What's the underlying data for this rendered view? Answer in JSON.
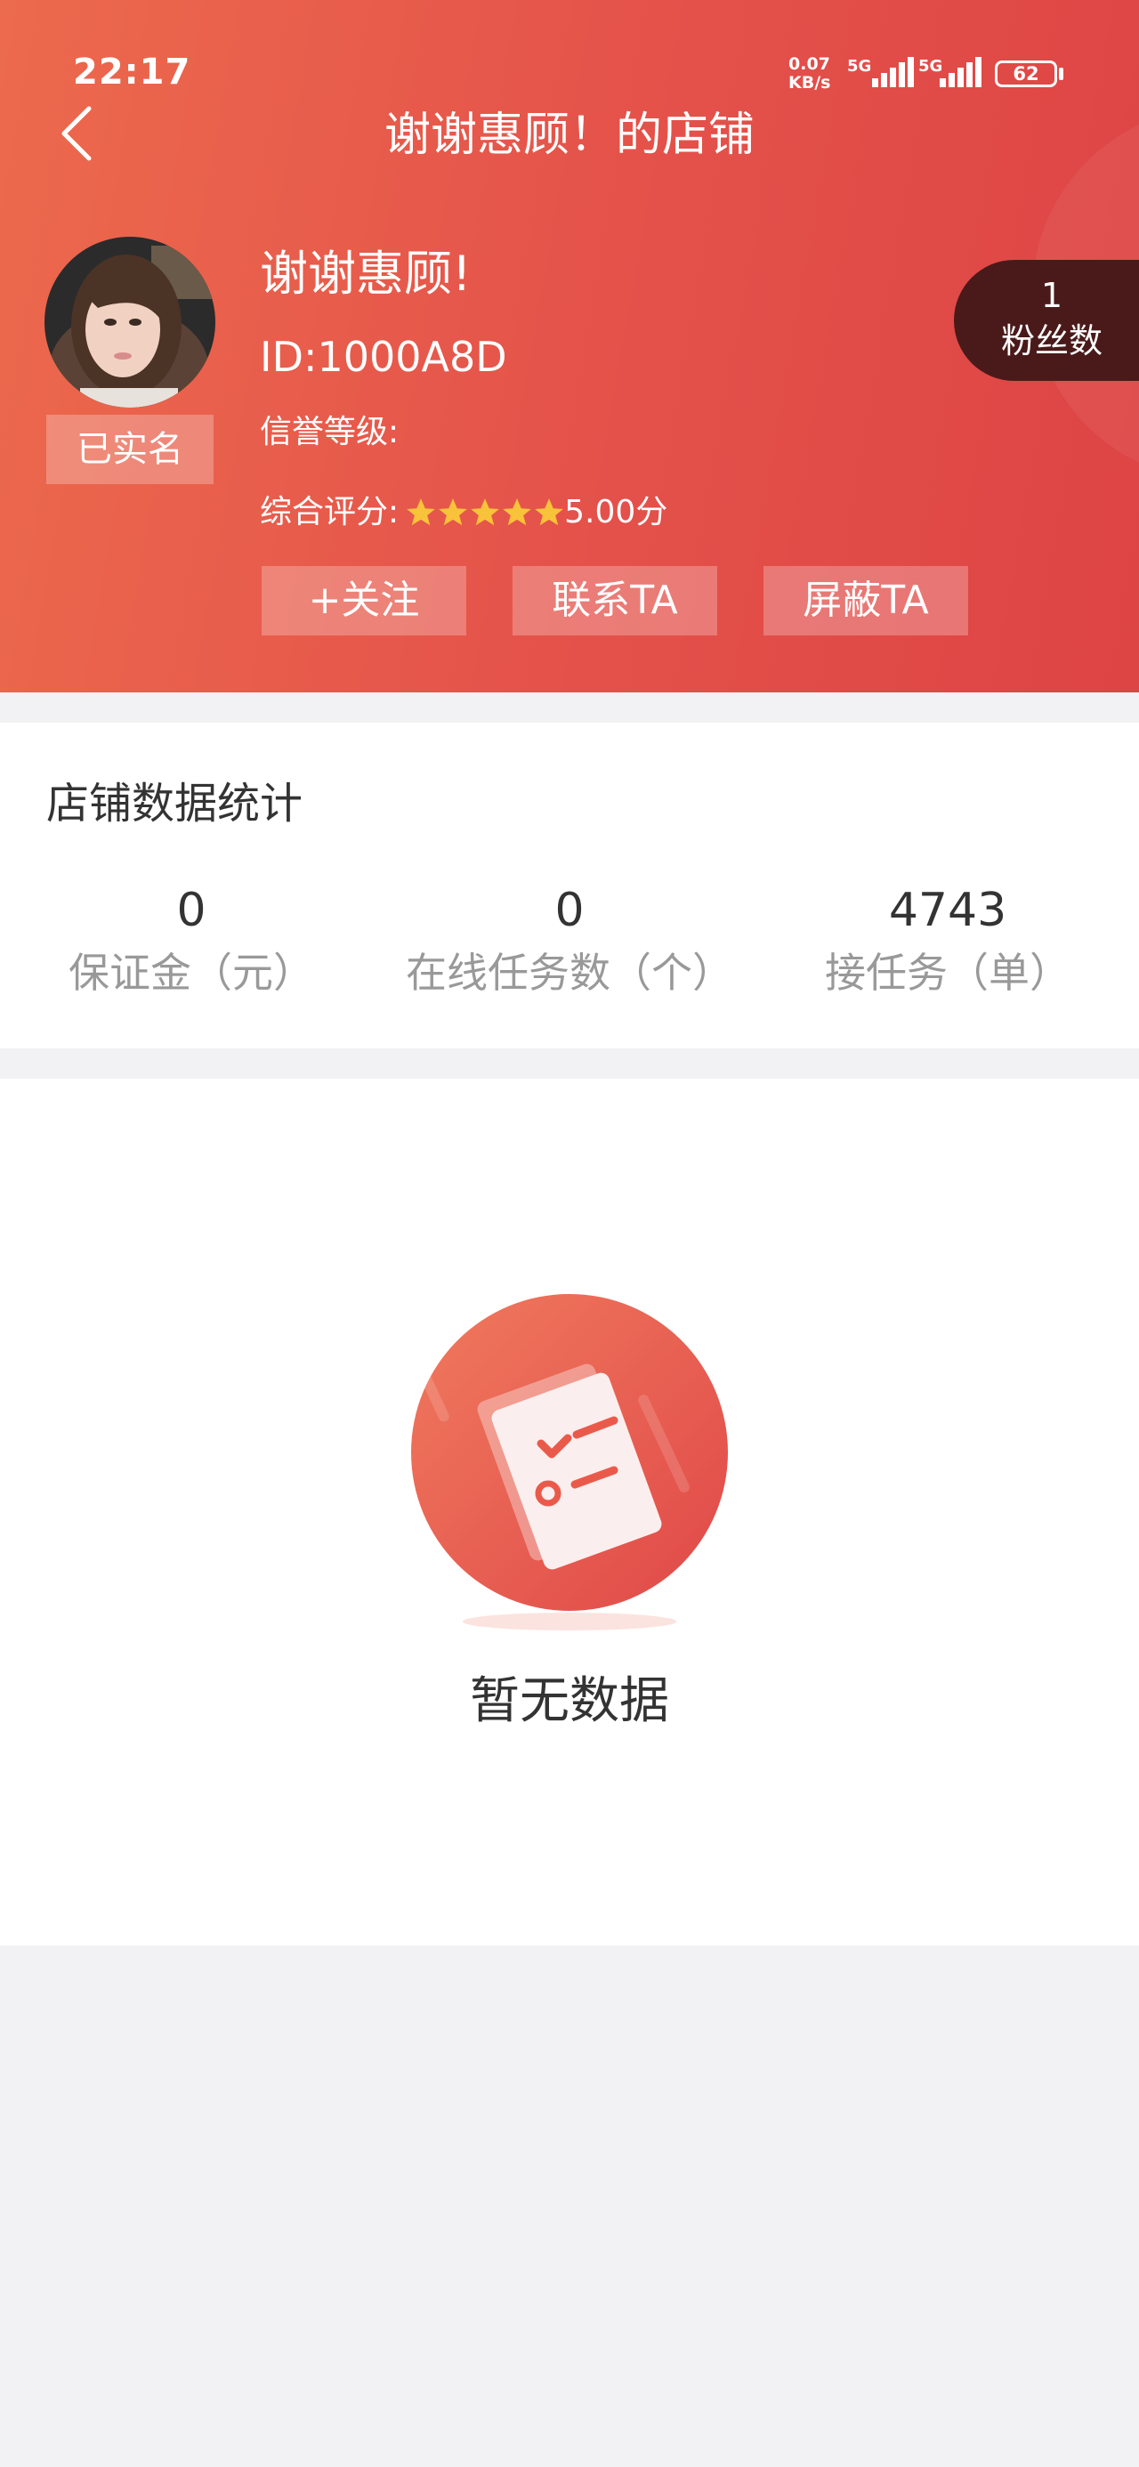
{
  "status_bar": {
    "time": "22:17",
    "net_speed_value": "0.07",
    "net_speed_unit": "KB/s",
    "signal1_label": "5G",
    "signal2_label": "5G",
    "battery": "62"
  },
  "header": {
    "title": "谢谢惠顾！的店铺"
  },
  "profile": {
    "verified_label": "已实名",
    "name": "谢谢惠顾!",
    "id": "ID:1000A8D",
    "credit_label": "信誉等级:",
    "rating_label": "综合评分:",
    "rating_score": "5.00分",
    "rating_stars": 5,
    "fans_count": "1",
    "fans_label": "粉丝数"
  },
  "actions": {
    "follow": "+关注",
    "contact": "联系TA",
    "block": "屏蔽TA"
  },
  "stats": {
    "title": "店铺数据统计",
    "items": [
      {
        "value": "0",
        "label": "保证金（元）"
      },
      {
        "value": "0",
        "label": "在线任务数（个）"
      },
      {
        "value": "4743",
        "label": "接任务（单）"
      }
    ]
  },
  "empty_state": {
    "text": "暂无数据"
  },
  "colors": {
    "header_gradient_start": "#ec6a4d",
    "header_gradient_end": "#dd4444",
    "fans_badge": "#4a1a1a",
    "star": "#f8c33a"
  }
}
